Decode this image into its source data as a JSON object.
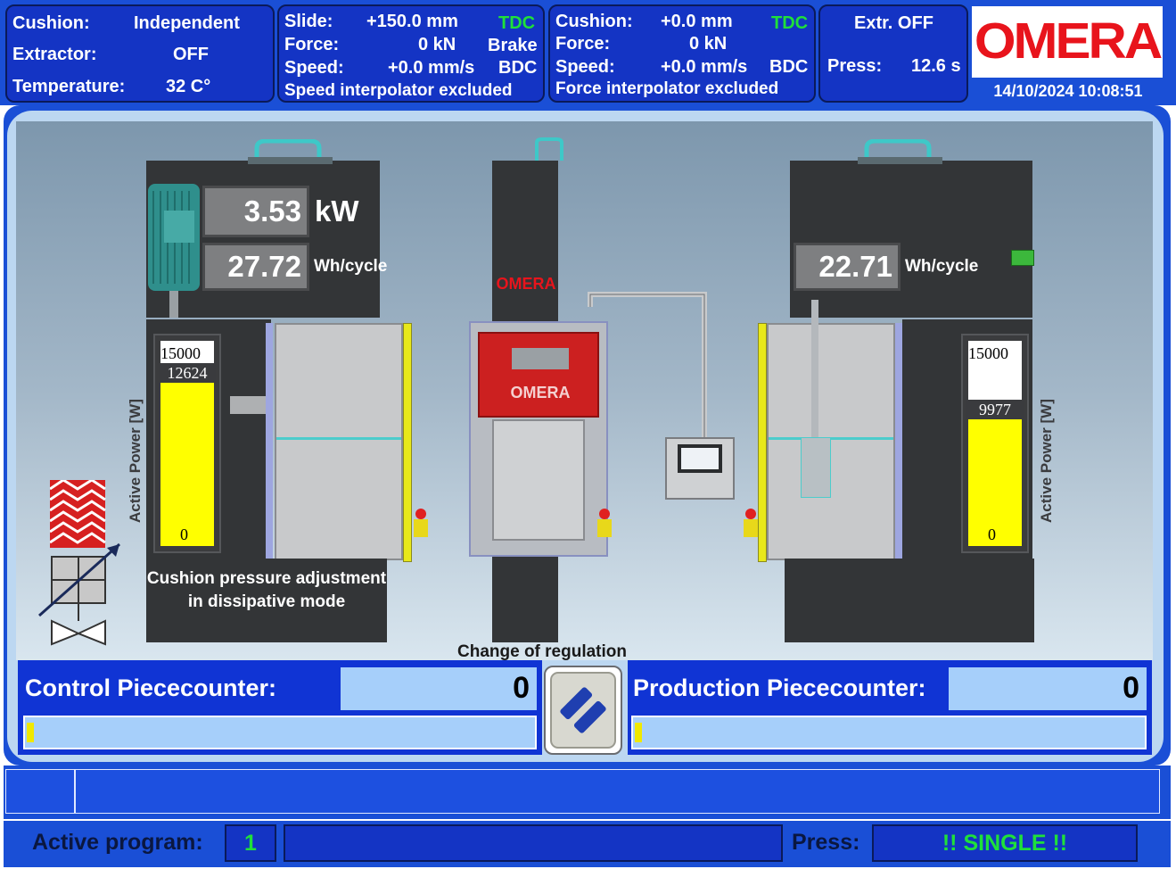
{
  "header": {
    "cushion_panel": {
      "cushion_label": "Cushion:",
      "cushion_value": "Independent",
      "extractor_label": "Extractor:",
      "extractor_value": "OFF",
      "temperature_label": "Temperature:",
      "temperature_value": "32 C°"
    },
    "slide_panel": {
      "slide_label": "Slide:",
      "slide_value": "+150.0 mm",
      "slide_state": "TDC",
      "force_label": "Force:",
      "force_value": "0 kN",
      "force_state": "Brake",
      "speed_label": "Speed:",
      "speed_value": "+0.0 mm/s",
      "speed_state": "BDC",
      "note": "Speed interpolator excluded"
    },
    "cushion2_panel": {
      "cushion_label": "Cushion:",
      "cushion_value": "+0.0 mm",
      "cushion_state": "TDC",
      "force_label": "Force:",
      "force_value": "0 kN",
      "speed_label": "Speed:",
      "speed_value": "+0.0 mm/s",
      "speed_state": "BDC",
      "note": "Force interpolator excluded"
    },
    "extr_panel": {
      "extr_text": "Extr. OFF",
      "press_label": "Press:",
      "press_value": "12.6 s"
    },
    "logo_text": "OMERA",
    "datetime": "14/10/2024  10:08:51"
  },
  "scene": {
    "left": {
      "power_value": "3.53",
      "power_unit": "kW",
      "energy_value": "27.72",
      "energy_unit": "Wh/cycle",
      "gauge_max": "15000",
      "gauge_min": "0",
      "gauge_current": "12624",
      "gauge_fraction": 0.842,
      "axis_label": "Active Power [W]",
      "info_text_1": "Cushion pressure adjustment",
      "info_text_2": "in dissipative mode"
    },
    "center": {
      "logo_top": "OMERA",
      "logo_mid": "OMERA",
      "change_label": "Change of regulation"
    },
    "right": {
      "energy_value": "22.71",
      "energy_unit": "Wh/cycle",
      "gauge_max": "15000",
      "gauge_min": "0",
      "gauge_current": "9977",
      "gauge_fraction": 0.665,
      "axis_label": "Active Power [W]"
    }
  },
  "counters": {
    "control_label": "Control Piececounter:",
    "control_value": "0",
    "production_label": "Production Piececounter:",
    "production_value": "0"
  },
  "footer": {
    "active_program_label": "Active program:",
    "active_program_value": "1",
    "press_label": "Press:",
    "press_mode": "!! SINGLE !!"
  },
  "colors": {
    "accent_blue": "#1a4fd6",
    "status_green": "#1fe03a",
    "brand_red": "#e8141c",
    "gauge_yellow": "#ffff00"
  }
}
